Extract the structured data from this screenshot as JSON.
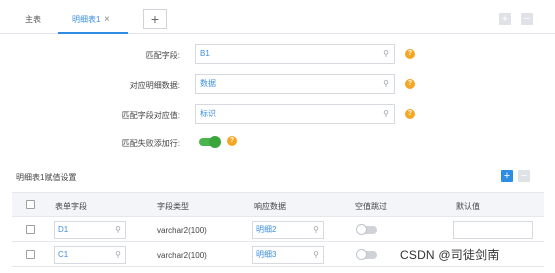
{
  "tabs": {
    "main_label": "主表",
    "detail_label": "明细表1",
    "close_glyph": "×",
    "add_glyph": "+"
  },
  "toolbar": {
    "add_glyph": "+",
    "minus_glyph": "−"
  },
  "form": {
    "match_field_label": "匹配字段:",
    "match_field_value": "B1",
    "detail_data_label": "对应明细数据:",
    "detail_data_value": "数据",
    "match_value_label": "匹配字段对应值:",
    "match_value_value": "标识",
    "fail_add_label": "匹配失败添加行:",
    "fail_add_enabled": true,
    "help_glyph": "?"
  },
  "section": {
    "title": "明细表1赋值设置",
    "add_glyph": "+",
    "minus_glyph": "−"
  },
  "table": {
    "columns": [
      "表单字段",
      "字段类型",
      "响应数据",
      "空值跳过",
      "默认值"
    ],
    "rows": [
      {
        "field": "D1",
        "type": "varchar2(100)",
        "response": "明细2",
        "skip_empty": false,
        "default": ""
      },
      {
        "field": "C1",
        "type": "varchar2(100)",
        "response": "明细3",
        "skip_empty": false,
        "default": ""
      }
    ]
  },
  "icons": {
    "search": "search-icon"
  },
  "colors": {
    "accent": "#2d8ce3",
    "help": "#f5a623",
    "toggle_on": "#4cb44c"
  },
  "watermark": "CSDN @司徒剑南"
}
